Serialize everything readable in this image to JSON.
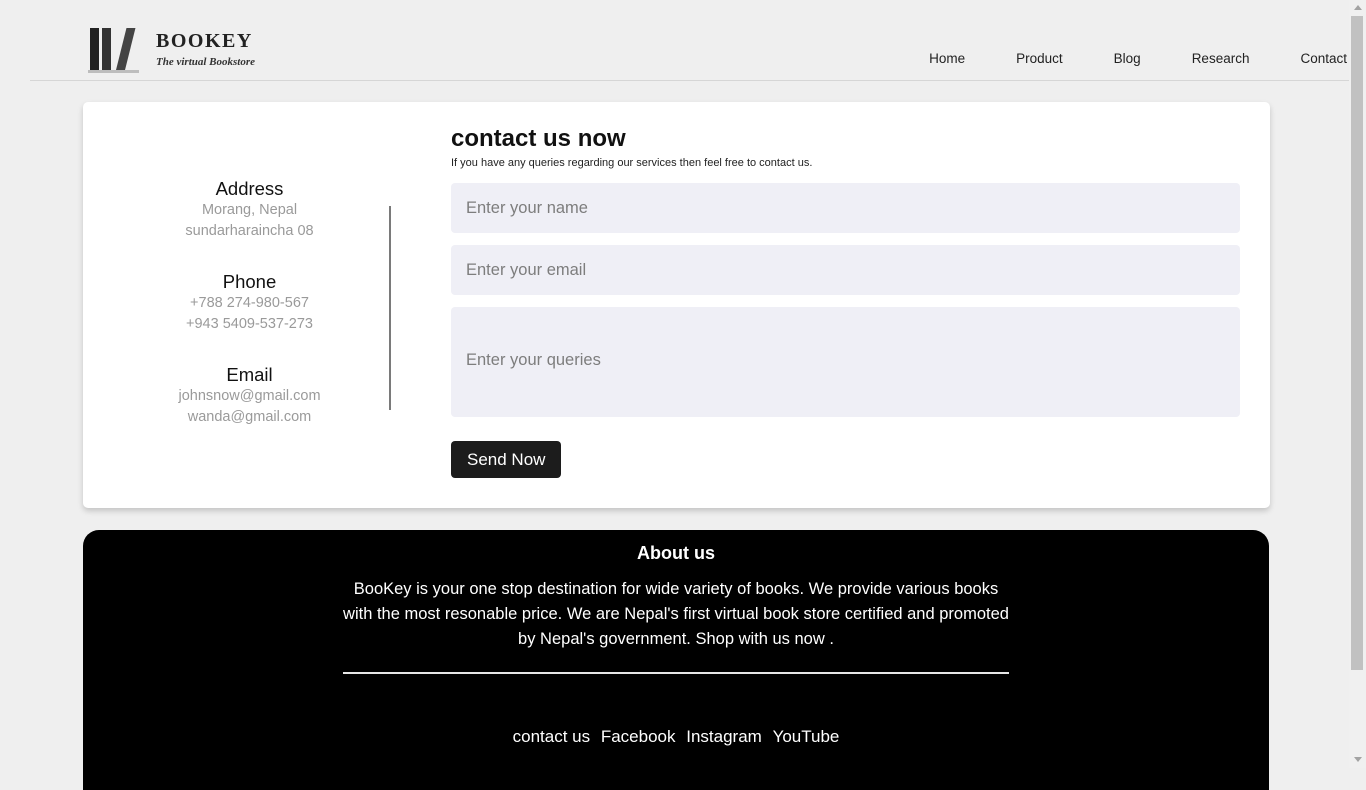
{
  "brand": {
    "title": "BOOKEY",
    "tagline": "The virtual Bookstore",
    "logo_icon": "bookshelf-icon"
  },
  "nav": [
    "Home",
    "Product",
    "Blog",
    "Research",
    "Contact"
  ],
  "contact_info": {
    "address_label": "Address",
    "address_lines": [
      "Morang, Nepal",
      "sundarharaincha 08"
    ],
    "phone_label": "Phone",
    "phone_lines": [
      "+788 274-980-567",
      "+943 5409-537-273"
    ],
    "email_label": "Email",
    "email_lines": [
      "johnsnow@gmail.com",
      "wanda@gmail.com"
    ]
  },
  "form": {
    "title": "contact us now",
    "subtitle": "If you have any queries regarding our services then feel free to contact us.",
    "name_placeholder": "Enter your name",
    "email_placeholder": "Enter your email",
    "query_placeholder": "Enter your queries",
    "submit_label": "Send Now"
  },
  "footer": {
    "about_title": "About us",
    "about_text": "BooKey is your one stop destination for wide variety of books. We provide various books with the most resonable price. We are Nepal's first virtual book store certified and promoted by Nepal's government. Shop with us now .",
    "links": [
      "contact us",
      "Facebook",
      "Instagram",
      "YouTube"
    ]
  },
  "colors": {
    "page_bg": "#efefef",
    "card_bg": "#ffffff",
    "field_bg": "#efeff6",
    "button_bg": "#1c1c1c",
    "footer_bg": "#000000",
    "muted_text": "#9a9a9a"
  }
}
